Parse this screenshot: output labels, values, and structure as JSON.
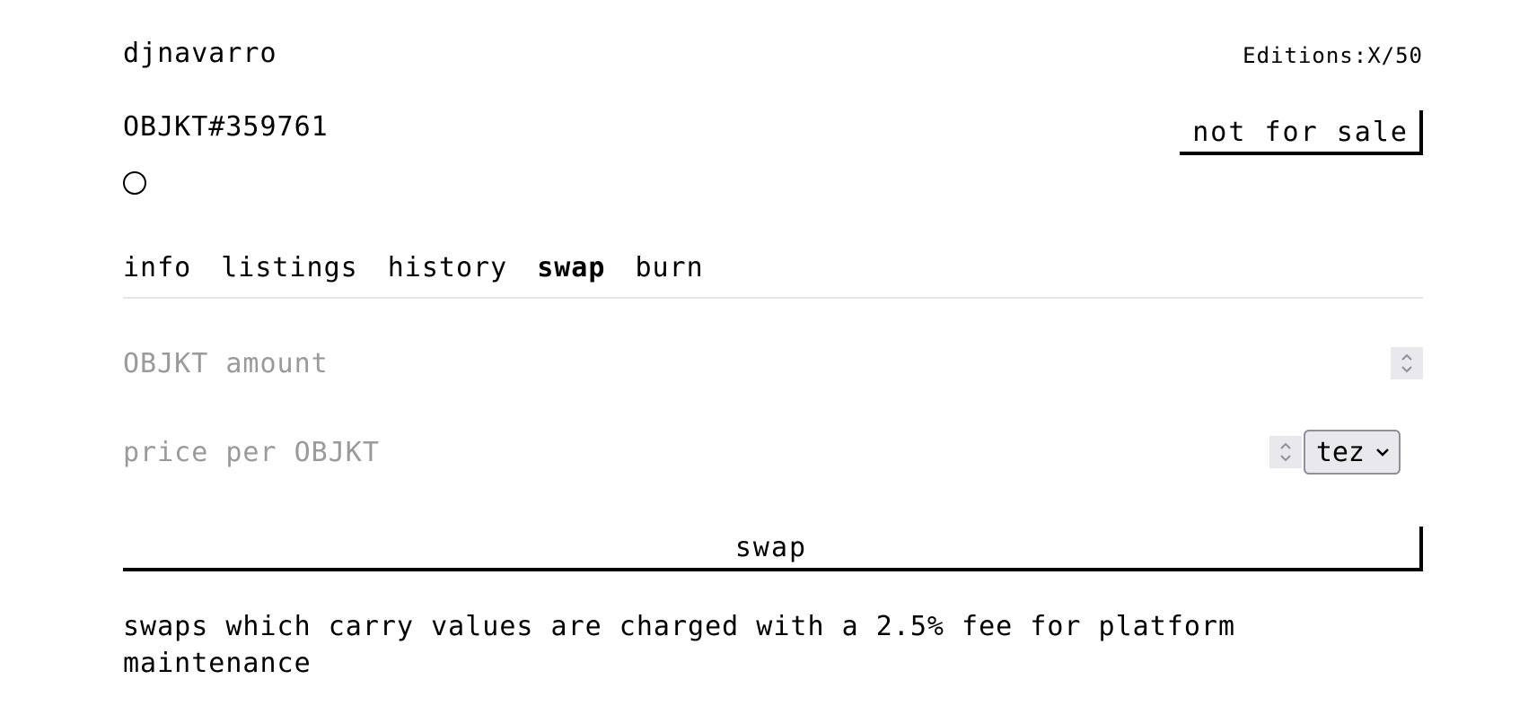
{
  "header": {
    "creator": "djnavarro",
    "editions": "Editions:X/50",
    "objkt_id": "OBJKT#359761",
    "status_button": "not for sale"
  },
  "tabs": [
    {
      "label": "info",
      "active": false
    },
    {
      "label": "listings",
      "active": false
    },
    {
      "label": "history",
      "active": false
    },
    {
      "label": "swap",
      "active": true
    },
    {
      "label": "burn",
      "active": false
    }
  ],
  "form": {
    "amount": {
      "value": "",
      "placeholder": "OBJKT amount"
    },
    "price": {
      "value": "",
      "placeholder": "price per OBJKT"
    },
    "currency": {
      "selected": "tez"
    },
    "submit_label": "swap"
  },
  "note": "swaps which carry values are charged with a 2.5% fee for platform maintenance",
  "icons": {
    "creator_status": "circle-icon",
    "spinner": "up-down-chevron-icon",
    "dropdown": "chevron-down-icon"
  }
}
